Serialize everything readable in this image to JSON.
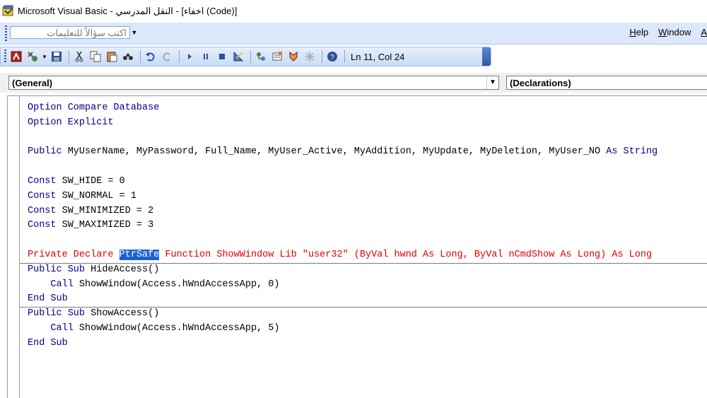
{
  "window": {
    "title": "Microsoft Visual Basic - النقل المدرسي - [اخفاء (Code)]"
  },
  "menubar": {
    "ask_placeholder": "اكتب سؤالاً للتعليمات",
    "menus": [
      {
        "label": "Help",
        "mnemonic": "H",
        "rest": "elp"
      },
      {
        "label": "Window",
        "mnemonic": "W",
        "rest": "indow"
      },
      {
        "label": "A",
        "mnemonic": "A",
        "rest": ""
      }
    ]
  },
  "toolbar": {
    "status": "Ln 11, Col 24"
  },
  "combos": {
    "object": "(General)",
    "procedure": "(Declarations)"
  },
  "code": {
    "lines": [
      {
        "kind": "kw",
        "text": "Option Compare Database"
      },
      {
        "kind": "kw",
        "text": "Option Explicit"
      },
      {
        "kind": "blank",
        "text": ""
      },
      {
        "kind": "public-decl",
        "pre": "Public",
        "mid": " MyUserName, MyPassword, Full_Name, MyUser_Active, MyAddition, MyUpdate, MyDeletion, MyUser_NO ",
        "post": "As String"
      },
      {
        "kind": "blank",
        "text": ""
      },
      {
        "kind": "const",
        "pre": "Const",
        "mid": " SW_HIDE = 0"
      },
      {
        "kind": "const",
        "pre": "Const",
        "mid": " SW_NORMAL = 1"
      },
      {
        "kind": "const",
        "pre": "Const",
        "mid": " SW_MINIMIZED = 2"
      },
      {
        "kind": "const",
        "pre": "Const",
        "mid": " SW_MAXIMIZED = 3"
      },
      {
        "kind": "blank",
        "text": ""
      },
      {
        "kind": "error",
        "pre": "Private Declare ",
        "sel": "PtrSafe",
        "post": " Function ShowWindow Lib \"user32\" (ByVal hwnd As Long, ByVal nCmdShow As Long) As Long"
      },
      {
        "kind": "sub",
        "pre": "Public Sub",
        "mid": " HideAccess()"
      },
      {
        "kind": "call",
        "pre": "    Call",
        "mid": " ShowWindow(Access.hWndAccessApp, 0)"
      },
      {
        "kind": "kw",
        "text": "End Sub"
      },
      {
        "kind": "sub",
        "pre": "Public Sub",
        "mid": " ShowAccess()"
      },
      {
        "kind": "call",
        "pre": "    Call",
        "mid": " ShowWindow(Access.hWndAccessApp, 5)"
      },
      {
        "kind": "kw",
        "text": "End Sub"
      }
    ]
  },
  "colors": {
    "keyword": "#00008b",
    "error": "#e00000",
    "selection": "#1a61d6",
    "menubar": "#dbe8fb"
  }
}
